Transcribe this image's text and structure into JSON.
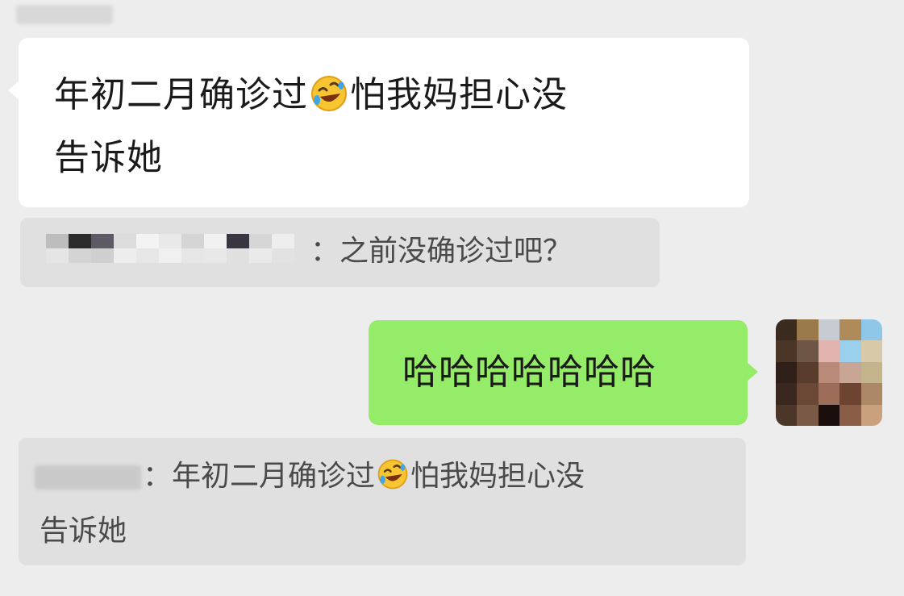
{
  "top_name_placeholder": "",
  "messages": [
    {
      "side": "left",
      "text_line1_a": "年初二月确诊过",
      "emoji": "rolling-on-floor-laughing",
      "text_line1_b": "怕我妈担心没",
      "text_line2": "告诉她"
    },
    {
      "side": "right",
      "text": "哈哈哈哈哈哈哈"
    }
  ],
  "quotes": [
    {
      "separator": "：",
      "text": "之前没确诊过吧？"
    },
    {
      "separator": "：",
      "text_line1_a": "年初二月确诊过",
      "emoji": "rolling-on-floor-laughing",
      "text_line1_b": "怕我妈担心没",
      "text_line2": "告诉她"
    }
  ],
  "colors": {
    "background": "#ededed",
    "incoming_bubble": "#ffffff",
    "outgoing_bubble": "#95ec69",
    "quote_bubble": "#e0e0e0"
  }
}
